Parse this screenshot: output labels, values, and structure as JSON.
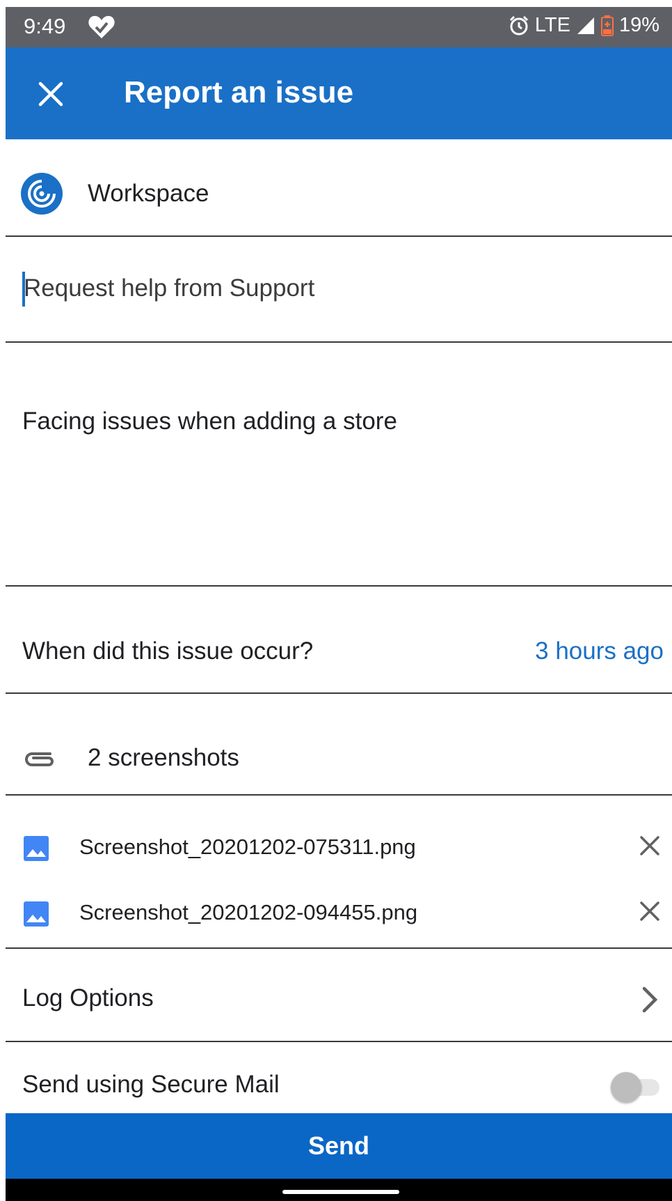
{
  "status_bar": {
    "time": "9:49",
    "network": "LTE",
    "battery": "19%"
  },
  "app_bar": {
    "title": "Report an issue",
    "close_icon": "close-icon"
  },
  "form": {
    "app_name": "Workspace",
    "subject_placeholder": "Request help from Support",
    "description": "Facing issues when adding a store",
    "when_label": "When did this issue occur?",
    "when_value": "3 hours ago",
    "attachments_label": "2 screenshots",
    "attachments": [
      {
        "name": "Screenshot_20201202-075311.png"
      },
      {
        "name": "Screenshot_20201202-094455.png"
      }
    ],
    "log_options_label": "Log Options",
    "secure_mail_label": "Send using Secure Mail",
    "secure_mail_enabled": false
  },
  "send_label": "Send",
  "colors": {
    "accent": "#1a70c6",
    "send_button": "#0a67c6",
    "status_bar": "#5f6066"
  }
}
